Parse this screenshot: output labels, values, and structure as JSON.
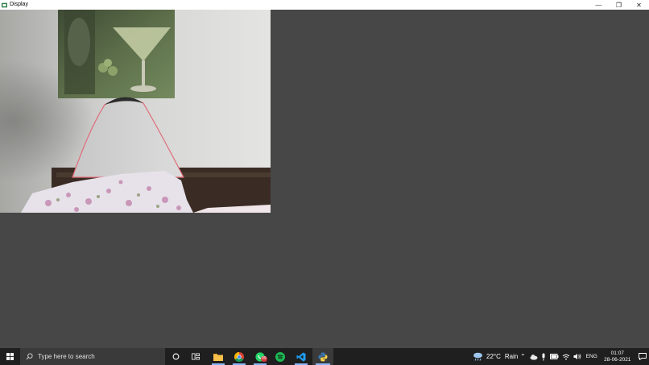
{
  "window": {
    "title": "Display",
    "minimize": "—",
    "restore": "❐",
    "close": "✕"
  },
  "taskbar": {
    "search_placeholder": "Type here to search",
    "weather": {
      "temp": "22°C",
      "desc": "Rain"
    },
    "language": "ENG",
    "time": "01:07",
    "date": "28-06-2021",
    "whatsapp_badge": "99"
  },
  "colors": {
    "taskbar": "#1f1f1f",
    "client_bg": "#474747",
    "accent": "#8ab4f8"
  }
}
